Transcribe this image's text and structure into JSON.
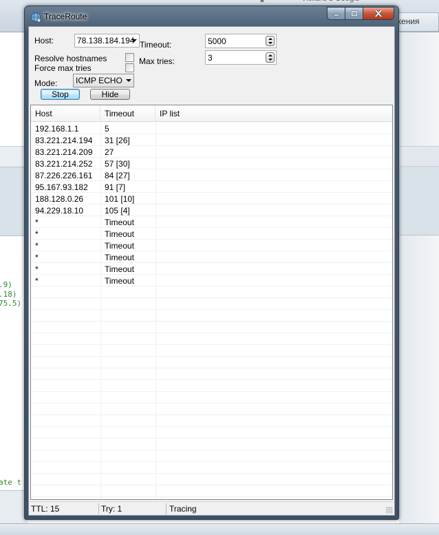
{
  "background": {
    "search_text": "Искать в Google",
    "tab_label": "жения",
    "code_lines": [
      ".9)",
      ".18)",
      "75.5)",
      "ate t"
    ]
  },
  "window": {
    "title": "TraceRoute",
    "icons": {
      "app": "network-globe-icon",
      "minimize": "minimize-icon",
      "maximize": "maximize-icon",
      "close": "close-icon"
    }
  },
  "form": {
    "host_label": "Host:",
    "host_value": "78.138.184.194",
    "timeout_label": "Timeout:",
    "timeout_value": "5000",
    "maxtries_label": "Max tries:",
    "maxtries_value": "3",
    "resolve_label": "Resolve hostnames",
    "force_label": "Force max tries",
    "mode_label": "Mode:",
    "mode_value": "ICMP ECHO",
    "stop_label": "Stop",
    "hide_label": "Hide"
  },
  "table": {
    "columns": [
      "Host",
      "Timeout",
      "IP list"
    ],
    "rows": [
      [
        "192.168.1.1",
        "5",
        ""
      ],
      [
        "83.221.214.194",
        "31 [26]",
        ""
      ],
      [
        "83.221.214.209",
        "27",
        ""
      ],
      [
        "83.221.214.252",
        "57 [30]",
        ""
      ],
      [
        "87.226.226.161",
        "84 [27]",
        ""
      ],
      [
        "95.167.93.182",
        "91 [7]",
        ""
      ],
      [
        "188.128.0.26",
        "101 [10]",
        ""
      ],
      [
        "94.229.18.10",
        "105 [4]",
        ""
      ],
      [
        "*",
        "Timeout",
        ""
      ],
      [
        "*",
        "Timeout",
        ""
      ],
      [
        "*",
        "Timeout",
        ""
      ],
      [
        "*",
        "Timeout",
        ""
      ],
      [
        "*",
        "Timeout",
        ""
      ],
      [
        "*",
        "Timeout",
        ""
      ]
    ]
  },
  "status": {
    "ttl": "TTL: 15",
    "try": "Try: 1",
    "state": "Tracing"
  }
}
